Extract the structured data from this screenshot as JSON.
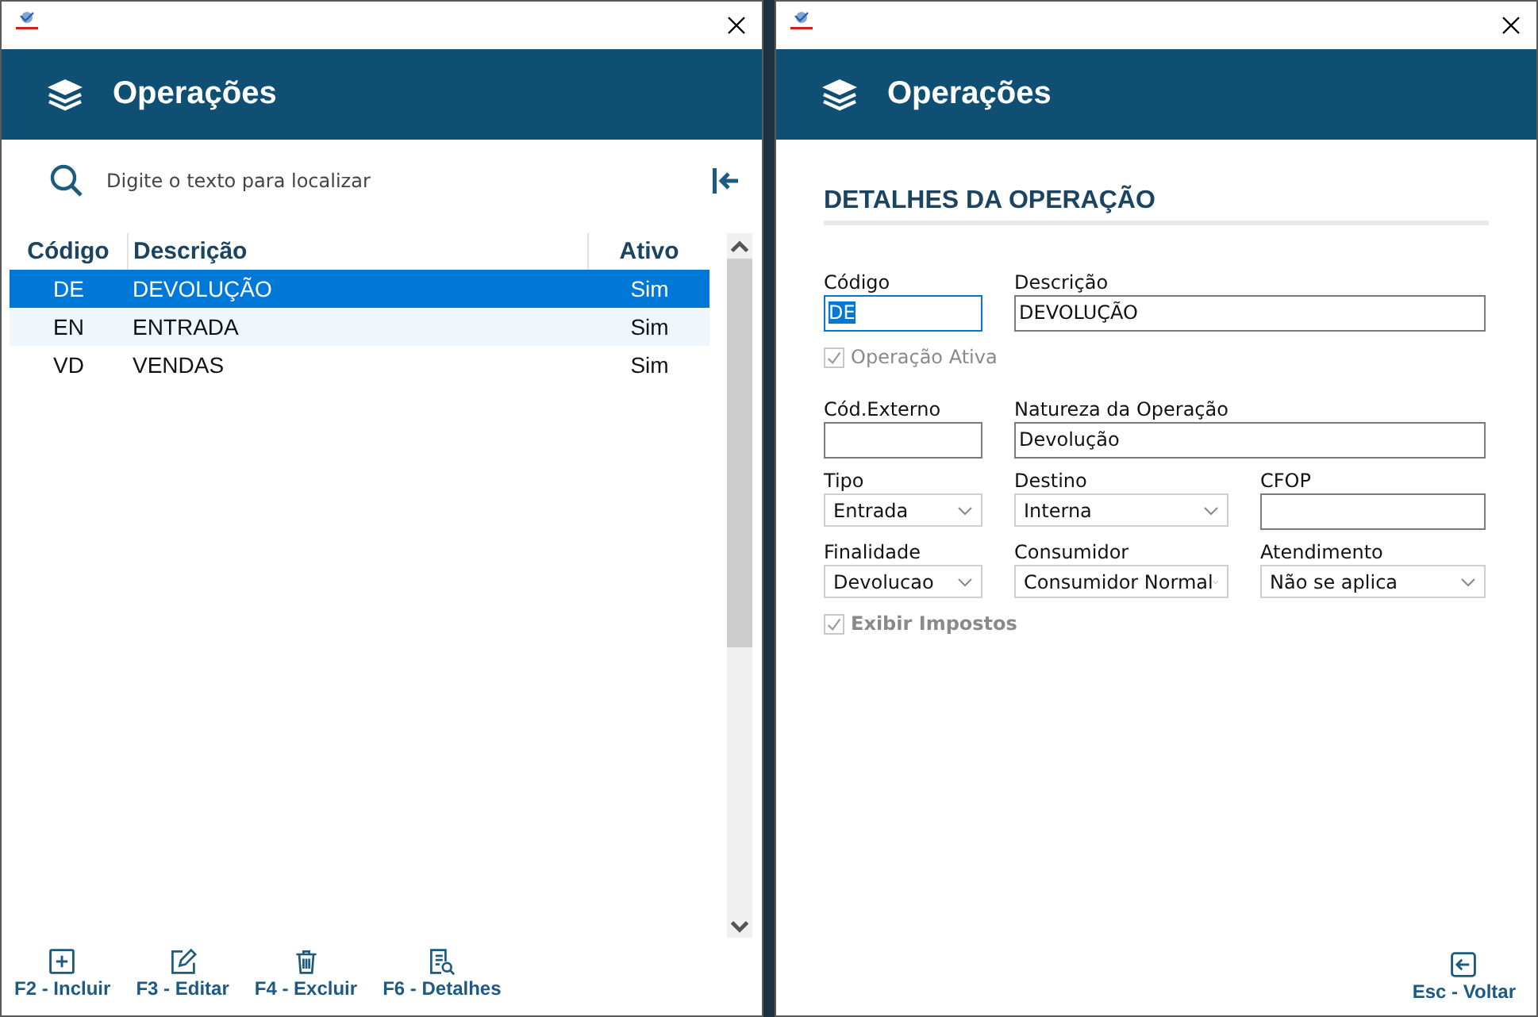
{
  "list_window": {
    "title": "Operações",
    "search": {
      "placeholder": "Digite o texto para localizar"
    },
    "table": {
      "columns": [
        "Código",
        "Descrição",
        "Ativo"
      ],
      "rows": [
        {
          "cells": [
            "DE",
            "DEVOLUÇÃO",
            "Sim"
          ],
          "selected": true
        },
        {
          "cells": [
            "EN",
            "ENTRADA",
            "Sim"
          ],
          "selected": false
        },
        {
          "cells": [
            "VD",
            "VENDAS",
            "Sim"
          ],
          "selected": false
        }
      ]
    },
    "actions": [
      {
        "label": "F2 - Incluir",
        "kind": "add"
      },
      {
        "label": "F3 - Editar",
        "kind": "edit"
      },
      {
        "label": "F4 - Excluir",
        "kind": "delete"
      },
      {
        "label": "F6 - Detalhes",
        "kind": "details"
      }
    ]
  },
  "detail_window": {
    "title": "Operações",
    "section_title": "DETALHES DA OPERAÇÃO",
    "rows": [
      [
        {
          "kind": "text",
          "label": "Código",
          "value": "DE",
          "focused": true
        },
        {
          "kind": "text",
          "label": "Descrição",
          "value": "DEVOLUÇÃO",
          "focused": false
        }
      ],
      [
        {
          "kind": "checkbox",
          "label": "Operação Ativa",
          "checked": true,
          "bold": false
        }
      ],
      [
        {
          "kind": "text",
          "label": "Cód.Externo",
          "focused": false
        },
        {
          "kind": "text",
          "label": "Natureza da Operação",
          "value": "Devolução",
          "focused": false
        }
      ],
      [
        {
          "kind": "select",
          "label": "Tipo",
          "value": "Entrada"
        },
        {
          "kind": "select",
          "label": "Destino",
          "value": "Interna"
        },
        {
          "kind": "text",
          "label": "CFOP",
          "focused": false
        }
      ],
      [
        {
          "kind": "select",
          "label": "Finalidade",
          "value": "Devolucao"
        },
        {
          "kind": "select",
          "label": "Consumidor",
          "value": "Consumidor Normal"
        },
        {
          "kind": "select",
          "label": "Atendimento",
          "value": "Não se aplica"
        }
      ],
      [
        {
          "kind": "checkbox",
          "label": "Exibir Impostos",
          "checked": true,
          "bold": true
        }
      ]
    ],
    "actions": [
      {
        "label": "Esc - Voltar",
        "kind": "back"
      }
    ]
  }
}
